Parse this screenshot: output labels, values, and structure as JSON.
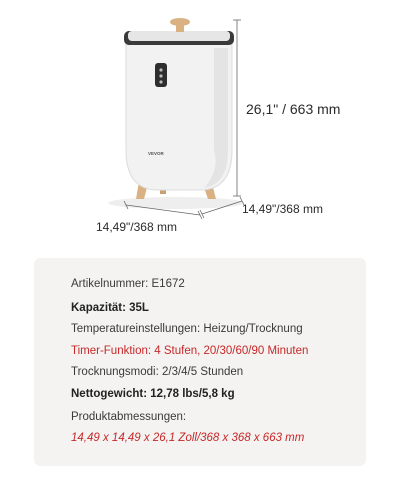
{
  "product": {
    "brand_label": "VEVOR",
    "dimensions": {
      "height": "26,1\" / 663 mm",
      "width": "14,49\"/368 mm",
      "depth": "14,49\"/368 mm"
    }
  },
  "specs": {
    "article_number": "Artikelnummer: E1672",
    "capacity": "Kapazität: 35L",
    "temperature_settings": "Temperatureinstellungen: Heizung/Trocknung",
    "timer_function": "Timer-Funktion: 4 Stufen, 20/30/60/90 Minuten",
    "drying_modes": "Trocknungsmodi: 2/3/4/5 Stunden",
    "net_weight": "Nettogewicht: 12,78 lbs/5,8 kg",
    "product_dimensions_label": "Produktabmessungen:",
    "product_dimensions_value": "14,49 x 14,49 x 26,1 Zoll/368 x 368 x 663 mm"
  },
  "colors": {
    "accent_red": "#c62828",
    "card_background": "#f4f3f2",
    "product_body": "#f2f2f2",
    "wood_legs": "#d9b183"
  }
}
